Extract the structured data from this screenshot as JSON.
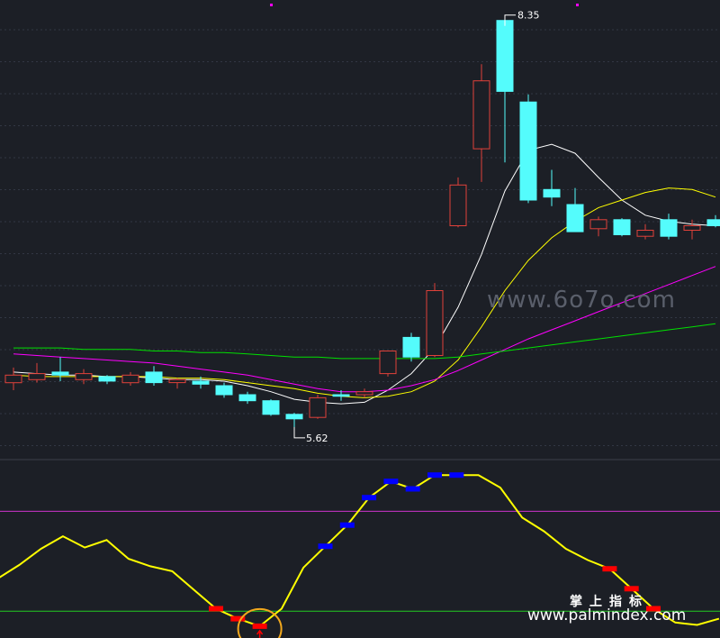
{
  "chart_data": [
    {
      "type": "candlestick",
      "candles": [
        {
          "open": 5.95,
          "close": 6.0,
          "high": 6.05,
          "low": 5.9
        },
        {
          "open": 5.97,
          "close": 6.01,
          "high": 6.08,
          "low": 5.95
        },
        {
          "open": 6.02,
          "close": 6.0,
          "high": 6.12,
          "low": 5.96
        },
        {
          "open": 5.97,
          "close": 6.01,
          "high": 6.04,
          "low": 5.94
        },
        {
          "open": 5.99,
          "close": 5.96,
          "high": 6.0,
          "low": 5.94
        },
        {
          "open": 5.95,
          "close": 6.0,
          "high": 6.02,
          "low": 5.93
        },
        {
          "open": 6.02,
          "close": 5.95,
          "high": 6.06,
          "low": 5.93
        },
        {
          "open": 5.95,
          "close": 5.97,
          "high": 5.98,
          "low": 5.91
        },
        {
          "open": 5.96,
          "close": 5.94,
          "high": 5.99,
          "low": 5.91
        },
        {
          "open": 5.93,
          "close": 5.87,
          "high": 5.95,
          "low": 5.85
        },
        {
          "open": 5.87,
          "close": 5.83,
          "high": 5.89,
          "low": 5.81
        },
        {
          "open": 5.83,
          "close": 5.74,
          "high": 5.84,
          "low": 5.73
        },
        {
          "open": 5.74,
          "close": 5.71,
          "high": 5.75,
          "low": 5.62
        },
        {
          "open": 5.72,
          "close": 5.85,
          "high": 5.87,
          "low": 5.71
        },
        {
          "open": 5.87,
          "close": 5.86,
          "high": 5.9,
          "low": 5.83
        },
        {
          "open": 5.87,
          "close": 5.89,
          "high": 5.91,
          "low": 5.85
        },
        {
          "open": 6.01,
          "close": 6.16,
          "high": 6.16,
          "low": 5.99
        },
        {
          "open": 6.25,
          "close": 6.12,
          "high": 6.28,
          "low": 6.09
        },
        {
          "open": 6.13,
          "close": 6.56,
          "high": 6.61,
          "low": 6.12
        },
        {
          "open": 6.99,
          "close": 7.26,
          "high": 7.31,
          "low": 6.98
        },
        {
          "open": 7.5,
          "close": 7.95,
          "high": 8.06,
          "low": 7.28
        },
        {
          "open": 8.35,
          "close": 7.88,
          "high": 8.35,
          "low": 7.41
        },
        {
          "open": 7.81,
          "close": 7.16,
          "high": 7.86,
          "low": 7.14
        },
        {
          "open": 7.23,
          "close": 7.18,
          "high": 7.36,
          "low": 7.12
        },
        {
          "open": 7.13,
          "close": 6.95,
          "high": 7.24,
          "low": 6.95
        },
        {
          "open": 6.97,
          "close": 7.03,
          "high": 7.05,
          "low": 6.92
        },
        {
          "open": 7.03,
          "close": 6.93,
          "high": 7.04,
          "low": 6.92
        },
        {
          "open": 6.92,
          "close": 6.96,
          "high": 7.0,
          "low": 6.9
        },
        {
          "open": 7.03,
          "close": 6.92,
          "high": 7.07,
          "low": 6.9
        },
        {
          "open": 6.96,
          "close": 6.99,
          "high": 7.03,
          "low": 6.9
        },
        {
          "open": 7.03,
          "close": 6.99,
          "high": 7.06,
          "low": 6.98
        }
      ],
      "ma_lines": [
        {
          "color": "#ffffff",
          "values": [
            6.02,
            6.01,
            6.0,
            6.0,
            5.99,
            5.99,
            5.98,
            5.97,
            5.97,
            5.96,
            5.93,
            5.89,
            5.84,
            5.82,
            5.81,
            5.82,
            5.9,
            6.01,
            6.18,
            6.45,
            6.8,
            7.22,
            7.49,
            7.53,
            7.47,
            7.31,
            7.16,
            7.06,
            7.02,
            7.0,
            6.99
          ]
        },
        {
          "color": "#ffff00",
          "values": [
            6.0,
            5.99,
            5.99,
            5.99,
            5.99,
            5.99,
            5.99,
            5.98,
            5.98,
            5.97,
            5.95,
            5.93,
            5.91,
            5.88,
            5.86,
            5.85,
            5.86,
            5.89,
            5.96,
            6.1,
            6.32,
            6.56,
            6.76,
            6.91,
            7.02,
            7.11,
            7.16,
            7.21,
            7.24,
            7.23,
            7.18
          ]
        },
        {
          "color": "#ff00ff",
          "values": [
            6.14,
            6.13,
            6.12,
            6.11,
            6.1,
            6.09,
            6.08,
            6.06,
            6.04,
            6.02,
            6.0,
            5.97,
            5.94,
            5.91,
            5.89,
            5.89,
            5.9,
            5.93,
            5.97,
            6.03,
            6.1,
            6.17,
            6.24,
            6.3,
            6.36,
            6.42,
            6.48,
            6.54,
            6.6,
            6.66,
            6.72
          ]
        },
        {
          "color": "#00e000",
          "values": [
            6.18,
            6.18,
            6.18,
            6.17,
            6.17,
            6.17,
            6.16,
            6.16,
            6.15,
            6.15,
            6.14,
            6.13,
            6.12,
            6.12,
            6.11,
            6.11,
            6.11,
            6.11,
            6.11,
            6.12,
            6.14,
            6.16,
            6.18,
            6.2,
            6.22,
            6.24,
            6.26,
            6.28,
            6.3,
            6.32,
            6.34
          ]
        }
      ],
      "annotations": [
        {
          "text": "8.35",
          "index": 21,
          "value": 8.35
        },
        {
          "text": "5.62",
          "index": 12,
          "value": 5.62
        }
      ],
      "ylim": [
        5.5,
        8.45
      ]
    },
    {
      "type": "line",
      "line_color": "#ffff00",
      "values": [
        46,
        57,
        70,
        80,
        71,
        77,
        62,
        56,
        52,
        37,
        22,
        14,
        8,
        22,
        55,
        72,
        89,
        111,
        124,
        118,
        129,
        129,
        129,
        119,
        95,
        84,
        70,
        61,
        54,
        38,
        22,
        11,
        9,
        14
      ],
      "markers": [
        {
          "index": 10,
          "color": "#ff0000"
        },
        {
          "index": 11,
          "color": "#ff0000"
        },
        {
          "index": 12,
          "color": "#ff0000",
          "arrow": true,
          "circled": true
        },
        {
          "index": 15,
          "color": "#0000ff"
        },
        {
          "index": 16,
          "color": "#0000ff"
        },
        {
          "index": 17,
          "color": "#0000ff"
        },
        {
          "index": 18,
          "color": "#0000ff"
        },
        {
          "index": 19,
          "color": "#0000ff"
        },
        {
          "index": 20,
          "color": "#0000ff"
        },
        {
          "index": 21,
          "color": "#0000ff"
        },
        {
          "index": 28,
          "color": "#ff0000"
        },
        {
          "index": 29,
          "color": "#ff0000"
        },
        {
          "index": 30,
          "color": "#ff0000"
        }
      ],
      "hlines": [
        {
          "value": 100,
          "color": "#cc33cc"
        },
        {
          "value": 20,
          "color": "#22cc22"
        }
      ],
      "ylim": [
        0,
        140
      ]
    }
  ],
  "colors": {
    "background": "#1c1f26",
    "up_candle": "#e0413a",
    "down_candle": "#54fcfc",
    "grid": "#323744",
    "separator": "#3b3f4a"
  },
  "watermark": {
    "mid": "www.6o7o.com",
    "cn": "掌上指标",
    "url": "www.palmindex.com"
  }
}
